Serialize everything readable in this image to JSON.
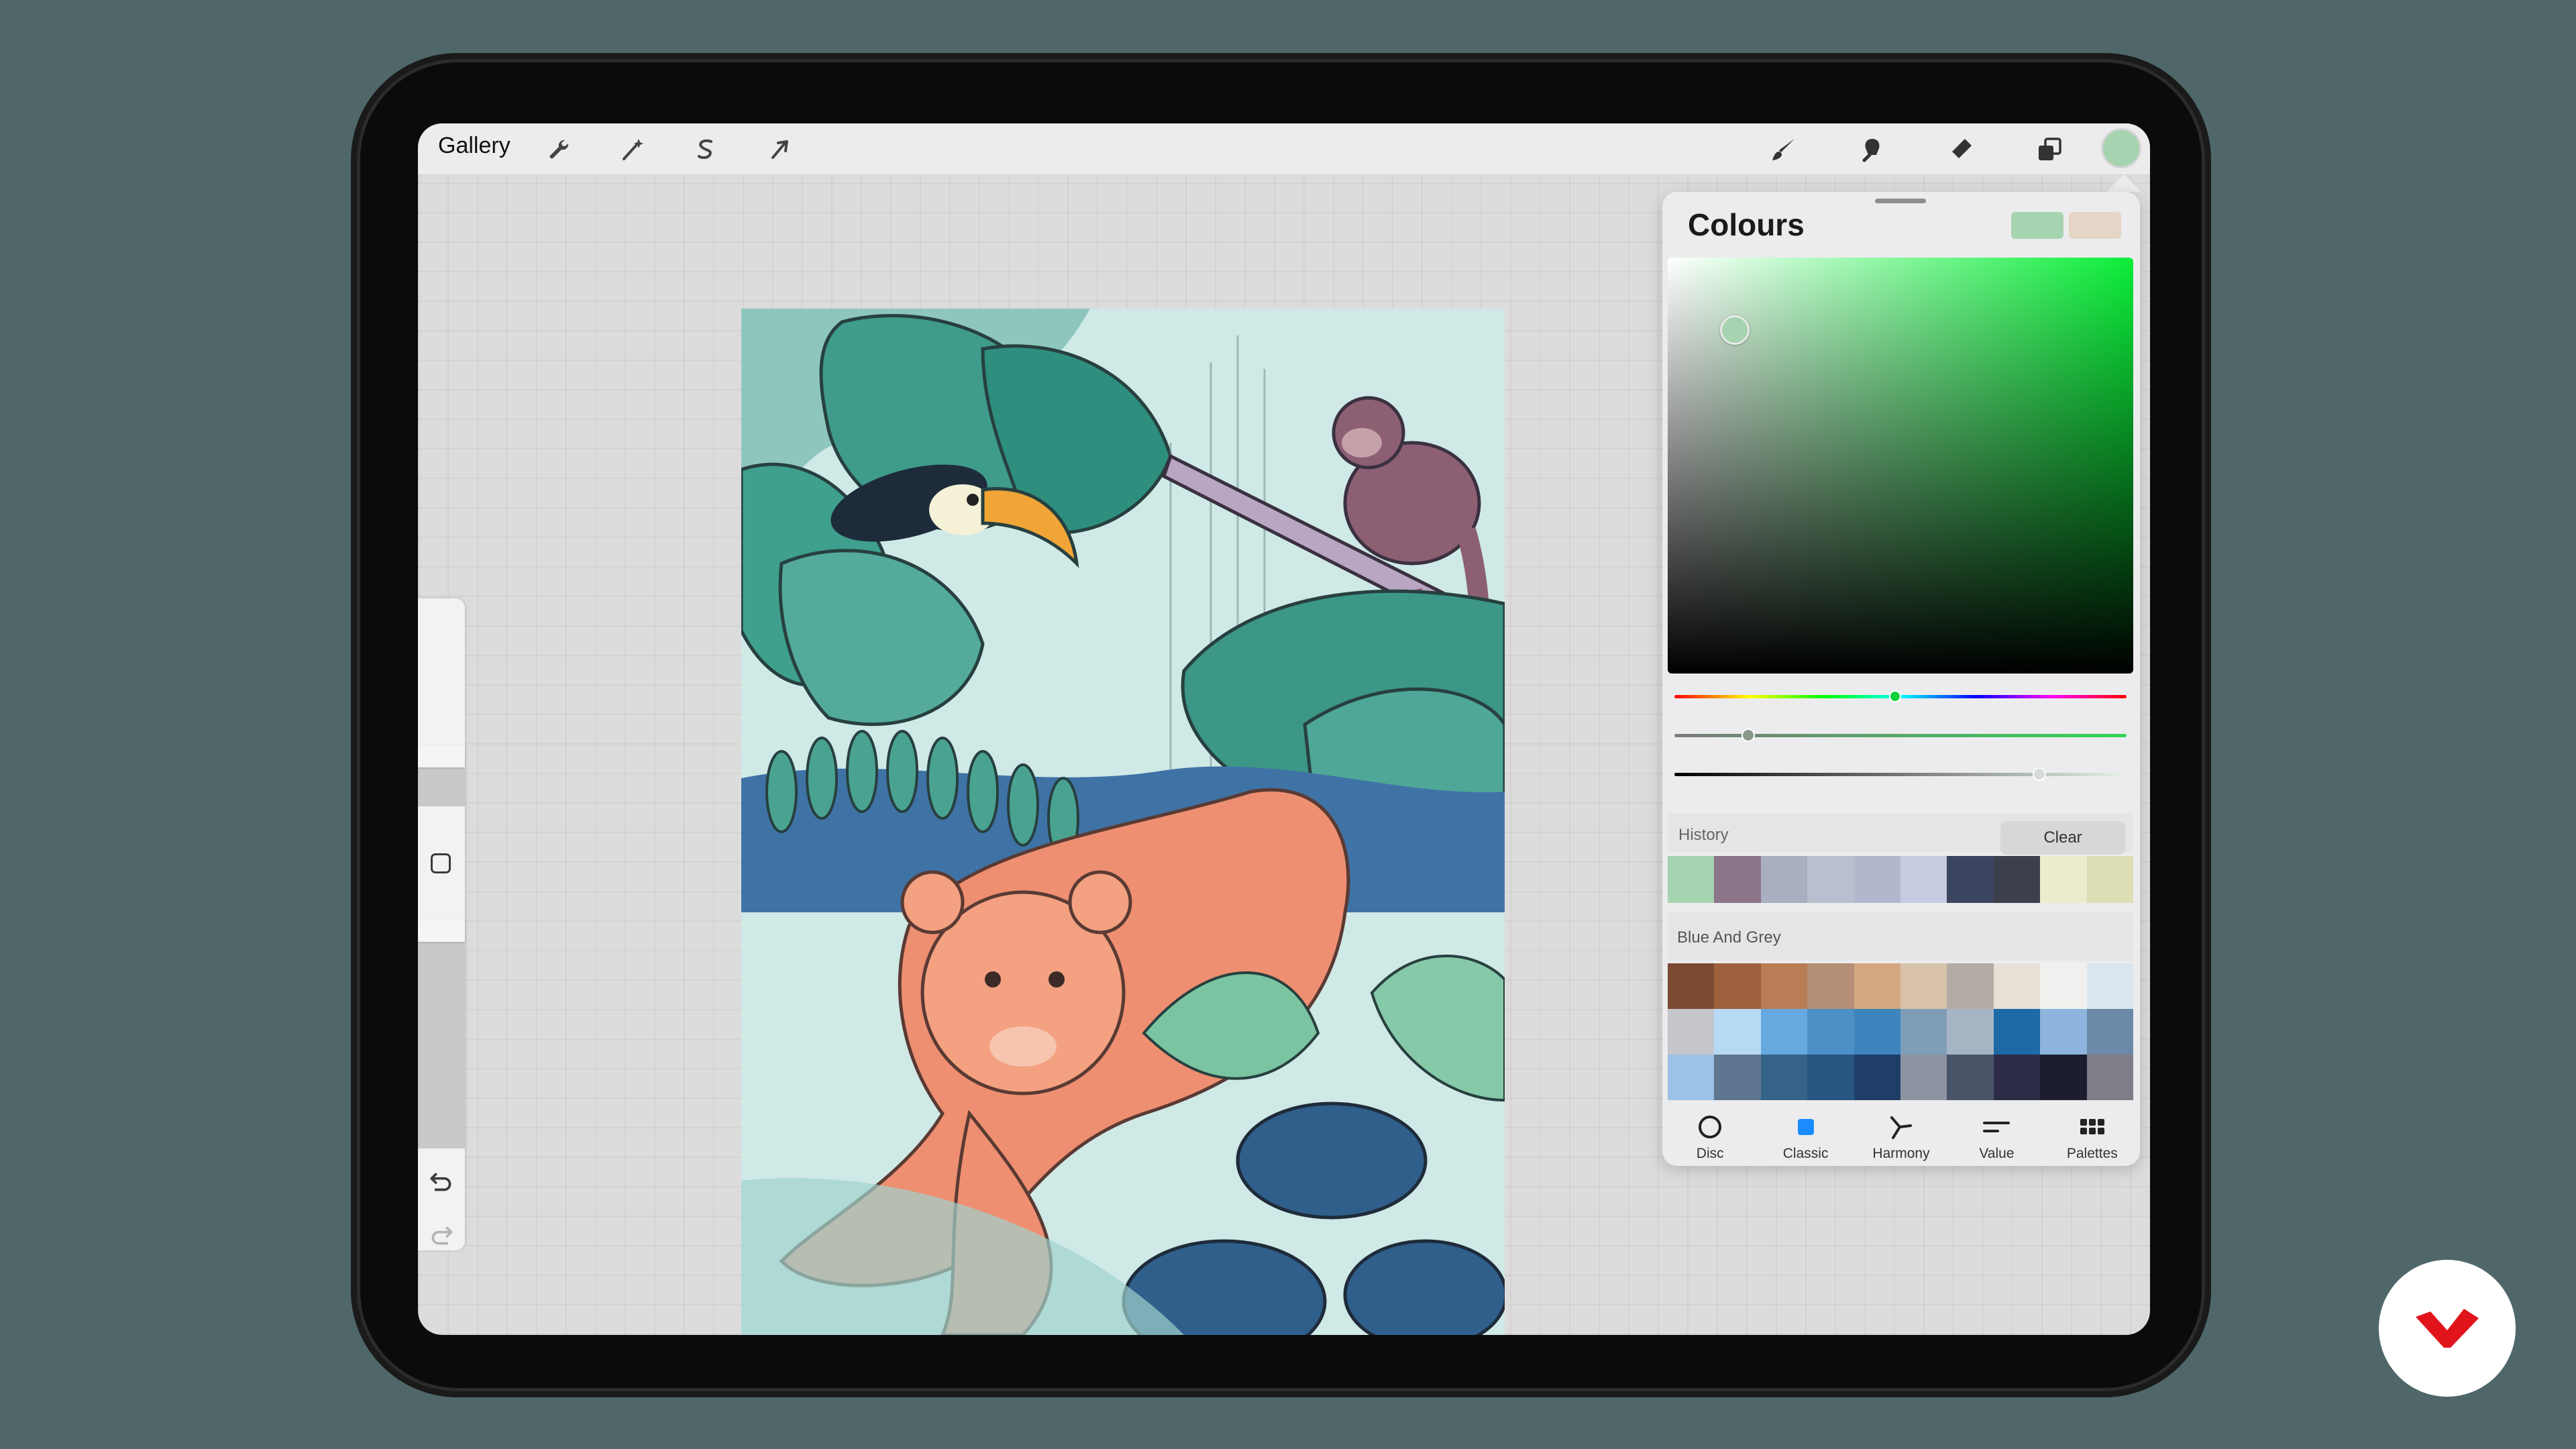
{
  "topbar": {
    "gallery_label": "Gallery",
    "left_tools": [
      "wrench-icon",
      "magic-wand-icon",
      "selection-icon",
      "transform-arrow-icon"
    ],
    "right_tools": [
      "brush-icon",
      "smudge-icon",
      "eraser-icon",
      "layers-icon"
    ],
    "current_colour": "#a6d3b0"
  },
  "colours": {
    "title": "Colours",
    "current_swatch": "#a6d3b0",
    "previous_swatch": "#e5d6c7",
    "hue_colour": "#0aee38",
    "history_label": "History",
    "clear_label": "Clear",
    "history": [
      "#a6d3b0",
      "#8c7589",
      "#a8afc0",
      "#b8bfce",
      "#b2b7cd",
      "#c7cbe1",
      "#3c4560",
      "#3b404c",
      "#ecebcb",
      "#dddeb6"
    ],
    "palette_label": "Blue And Grey",
    "palette": [
      "#7a4a33",
      "#a0623e",
      "#b87d54",
      "#b58f77",
      "#d3a881",
      "#d9c2ab",
      "#b4aba6",
      "#e8e0d6",
      "#f0f1ee",
      "#d9e6f0",
      "#c4c6cc",
      "#b6daf4",
      "#66a8e0",
      "#4c90c8",
      "#3d85bc",
      "#7e9eb8",
      "#a6b5c4",
      "#1d6aa6",
      "#8cb4dc",
      "#6c8aa8",
      "#9cc2e8",
      "#5e7690",
      "#366288",
      "#285482",
      "#1e3e68",
      "#8e93a2",
      "#4a5468",
      "#2c2c48",
      "#1d1d30",
      "#7e7e88"
    ],
    "tabs": [
      {
        "label": "Disc"
      },
      {
        "label": "Classic"
      },
      {
        "label": "Harmony"
      },
      {
        "label": "Value"
      },
      {
        "label": "Palettes"
      }
    ]
  }
}
